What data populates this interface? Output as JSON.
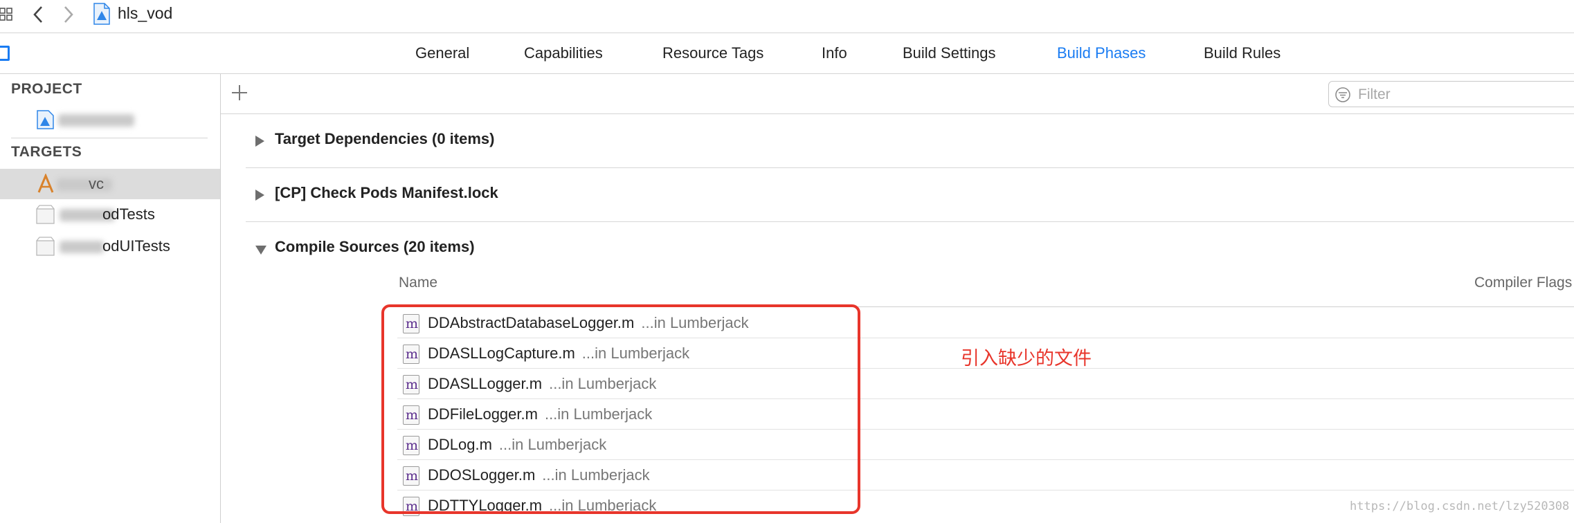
{
  "window": {
    "file_title": "hls_vod"
  },
  "tabs": [
    {
      "label": "General"
    },
    {
      "label": "Capabilities"
    },
    {
      "label": "Resource Tags"
    },
    {
      "label": "Info"
    },
    {
      "label": "Build Settings"
    },
    {
      "label": "Build Phases",
      "active": true
    },
    {
      "label": "Build Rules"
    }
  ],
  "colors": {
    "accent": "#1a7cf2",
    "annotation": "#e8352b"
  },
  "sidebar": {
    "project_header": "PROJECT",
    "targets_header": "TARGETS",
    "targets": [
      {
        "label": "vc",
        "selected": true
      },
      {
        "label": "odTests"
      },
      {
        "label": "odUITests"
      }
    ]
  },
  "toolbar": {
    "filter_placeholder": "Filter"
  },
  "phases": [
    {
      "title": "Target Dependencies (0 items)",
      "expanded": false
    },
    {
      "title": "[CP] Check Pods Manifest.lock",
      "expanded": false
    },
    {
      "title": "Compile Sources (20 items)",
      "expanded": true
    }
  ],
  "compile_sources": {
    "columns": {
      "name": "Name",
      "compiler_flags": "Compiler Flags"
    },
    "files": [
      {
        "name": "DDAbstractDatabaseLogger.m",
        "location": "...in Lumberjack"
      },
      {
        "name": "DDASLLogCapture.m",
        "location": "...in Lumberjack"
      },
      {
        "name": "DDASLLogger.m",
        "location": "...in Lumberjack"
      },
      {
        "name": "DDFileLogger.m",
        "location": "...in Lumberjack"
      },
      {
        "name": "DDLog.m",
        "location": "...in Lumberjack"
      },
      {
        "name": "DDOSLogger.m",
        "location": "...in Lumberjack"
      },
      {
        "name": "DDTTYLogger.m",
        "location": "...in Lumberjack"
      }
    ],
    "file_icon_letter": "m"
  },
  "annotation": {
    "text": "引入缺少的文件"
  },
  "watermark": {
    "text": "https://blog.csdn.net/lzy520308"
  }
}
